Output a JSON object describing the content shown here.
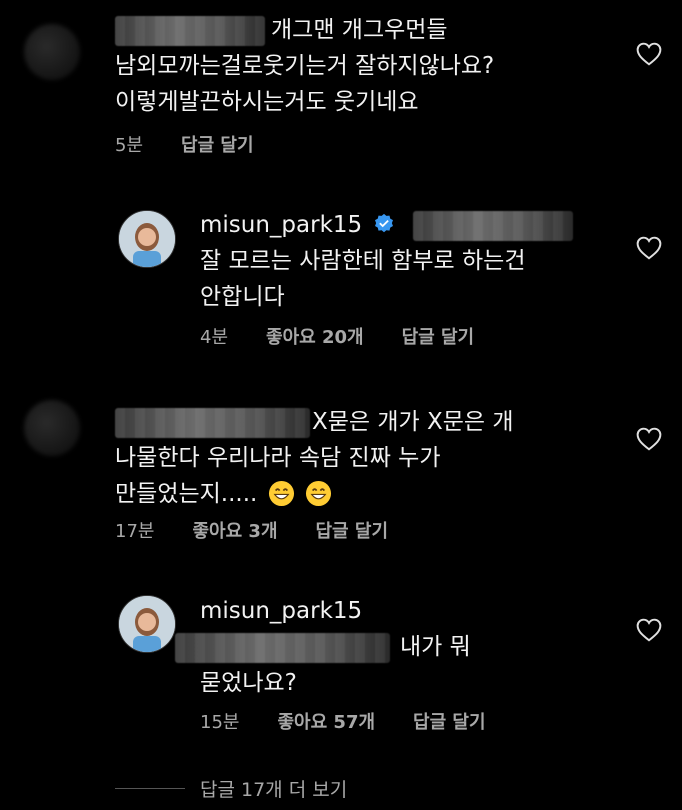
{
  "comments": [
    {
      "line1": "개그맨 개그우먼들",
      "line2": "남외모까는걸로웃기는거 잘하지않나요?",
      "line3": "이렇게발끈하시는거도 웃기네요",
      "time": "5분",
      "reply": "답글 달기"
    },
    {
      "username": "misun_park15",
      "line1": "잘 모르는 사람한테  함부로 하는건",
      "line2": "안합니다",
      "time": "4분",
      "likes": "좋아요 20개",
      "reply": "답글 달기"
    },
    {
      "line1": "X묻은 개가 X문은 개",
      "line2": "나물한다 우리나라 속담 진짜 누가",
      "line3": "만들었는지.....",
      "time": "17분",
      "likes": "좋아요 3개",
      "reply": "답글 달기"
    },
    {
      "username": "misun_park15",
      "line1": "내가  뭐",
      "line2": "묻었나요?",
      "time": "15분",
      "likes": "좋아요 57개",
      "reply": "답글 달기"
    }
  ],
  "view_more": "답글 17개 더 보기",
  "colors": {
    "background": "#000000",
    "text": "#f2f2f2",
    "meta": "#a8a8a8",
    "verified": "#3897f0"
  },
  "icons": [
    "heart-icon",
    "verified-badge-icon",
    "grinning-emoji-icon"
  ]
}
